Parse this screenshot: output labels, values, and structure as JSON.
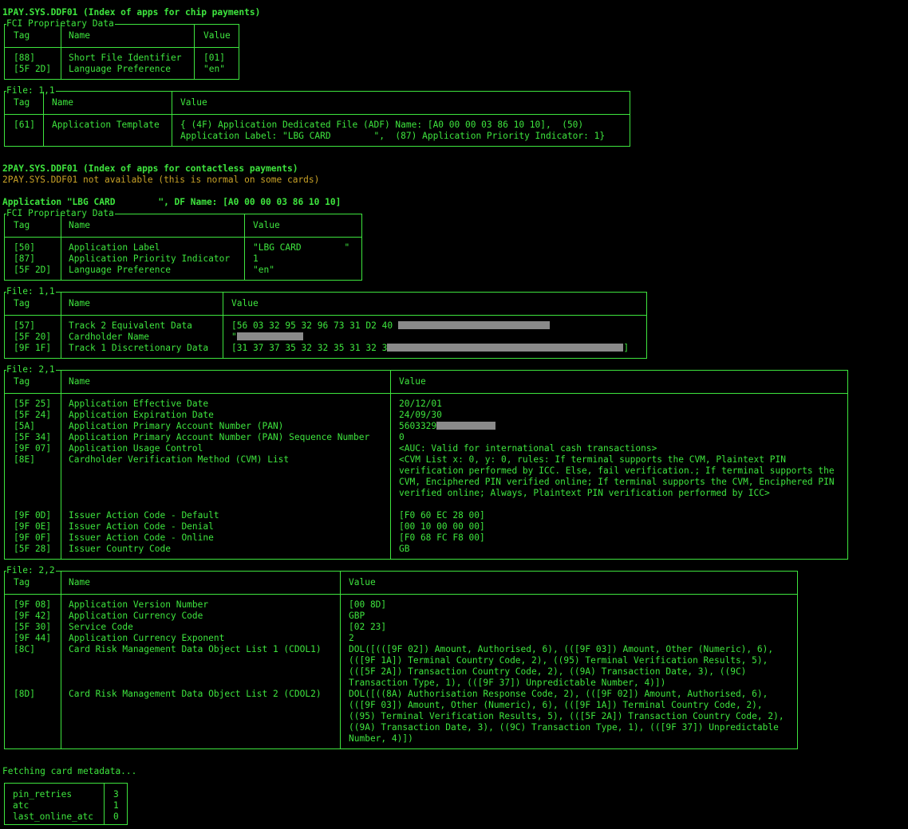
{
  "header_ppse": "1PAY.SYS.DDF01 (Index of apps for chip payments)",
  "fci1": {
    "label": "FCI Proprietary Data",
    "cols": [
      "Tag",
      "Name",
      "Value"
    ],
    "rows": [
      {
        "tag": "[88]",
        "name": "Short File Identifier",
        "value": "[01]"
      },
      {
        "tag": "[5F 2D]",
        "name": "Language Preference",
        "value": "\"en\""
      }
    ]
  },
  "file11a": {
    "label": "File: 1,1",
    "cols": [
      "Tag",
      "Name",
      "Value"
    ],
    "rows": [
      {
        "tag": "[61]",
        "name": "Application Template",
        "value_l1": "{ (4F) Application Dedicated File (ADF) Name: [A0 00 00 03 86 10 10],  (50)",
        "value_l2": "Application Label: \"LBG CARD        \",  (87) Application Priority Indicator: 1}"
      }
    ]
  },
  "header_contactless": "2PAY.SYS.DDF01 (Index of apps for contactless payments)",
  "contactless_msg": "2PAY.SYS.DDF01 not available (this is normal on some cards)",
  "header_app": "Application \"LBG CARD        \", DF Name: [A0 00 00 03 86 10 10]",
  "fci2": {
    "label": "FCI Proprietary Data",
    "cols": [
      "Tag",
      "Name",
      "Value"
    ],
    "rows": [
      {
        "tag": "[50]",
        "name": "Application Label",
        "value": "\"LBG CARD        \""
      },
      {
        "tag": "[87]",
        "name": "Application Priority Indicator",
        "value": "1"
      },
      {
        "tag": "[5F 2D]",
        "name": "Language Preference",
        "value": "\"en\""
      }
    ]
  },
  "file11b": {
    "label": "File: 1,1",
    "cols": [
      "Tag",
      "Name",
      "Value"
    ],
    "rows": [
      {
        "tag": "[57]",
        "name": "Track 2 Equivalent Data",
        "value": "[56 03 32 95 32 96 73 31 D2 40 "
      },
      {
        "tag": "[5F 20]",
        "name": "Cardholder Name",
        "value": "\""
      },
      {
        "tag": "[9F 1F]",
        "name": "Track 1 Discretionary Data",
        "value": "[31 37 37 35 32 32 35 31 32 3",
        "value_end": "]"
      }
    ]
  },
  "file21": {
    "label": "File: 2,1",
    "cols": [
      "Tag",
      "Name",
      "Value"
    ],
    "rows": [
      {
        "tag": "[5F 25]",
        "name": "Application Effective Date",
        "value": "20/12/01"
      },
      {
        "tag": "[5F 24]",
        "name": "Application Expiration Date",
        "value": "24/09/30"
      },
      {
        "tag": "[5A]",
        "name": "Application Primary Account Number (PAN)",
        "value": "5603329"
      },
      {
        "tag": "[5F 34]",
        "name": "Application Primary Account Number (PAN) Sequence Number",
        "value": "0"
      },
      {
        "tag": "[9F 07]",
        "name": "Application Usage Control",
        "value": "<AUC: Valid for international cash transactions>"
      },
      {
        "tag": "[8E]",
        "name": "Cardholder Verification Method (CVM) List",
        "value": "<CVM List x: 0, y: 0, rules: If terminal supports the CVM, Plaintext PIN verification performed by ICC. Else, fail verification.; If terminal supports the CVM, Enciphered PIN verified online; If terminal supports the CVM, Enciphered PIN verified online; Always, Plaintext PIN verification performed by ICC>"
      },
      {
        "tag": "[9F 0D]",
        "name": "Issuer Action Code - Default",
        "value": "[F0 60 EC 28 00]"
      },
      {
        "tag": "[9F 0E]",
        "name": "Issuer Action Code - Denial",
        "value": "[00 10 00 00 00]"
      },
      {
        "tag": "[9F 0F]",
        "name": "Issuer Action Code - Online",
        "value": "[F0 68 FC F8 00]"
      },
      {
        "tag": "[5F 28]",
        "name": "Issuer Country Code",
        "value": "GB"
      }
    ]
  },
  "file22": {
    "label": "File: 2,2",
    "cols": [
      "Tag",
      "Name",
      "Value"
    ],
    "rows": [
      {
        "tag": "[9F 08]",
        "name": "Application Version Number",
        "value": "[00 8D]"
      },
      {
        "tag": "[9F 42]",
        "name": "Application Currency Code",
        "value": "GBP"
      },
      {
        "tag": "[5F 30]",
        "name": "Service Code",
        "value": "[02 23]"
      },
      {
        "tag": "[9F 44]",
        "name": "Application Currency Exponent",
        "value": "2"
      },
      {
        "tag": "[8C]",
        "name": "Card Risk Management Data Object List 1 (CDOL1)",
        "value": "DOL([(([9F 02]) Amount, Authorised, 6), (([9F 03]) Amount, Other (Numeric), 6), (([9F 1A]) Terminal Country Code, 2), ((95) Terminal Verification Results, 5), (([5F 2A]) Transaction Country Code, 2), ((9A) Transaction Date, 3), ((9C) Transaction Type, 1), (([9F 37]) Unpredictable Number, 4)])"
      },
      {
        "tag": "[8D]",
        "name": "Card Risk Management Data Object List 2 (CDOL2)",
        "value": "DOL([((8A) Authorisation Response Code, 2), (([9F 02]) Amount, Authorised, 6), (([9F 03]) Amount, Other (Numeric), 6), (([9F 1A]) Terminal Country Code, 2), ((95) Terminal Verification Results, 5), (([5F 2A]) Transaction Country Code, 2), ((9A) Transaction Date, 3), ((9C) Transaction Type, 1), (([9F 37]) Unpredictable Number, 4)])"
      }
    ]
  },
  "fetching_msg": "Fetching card metadata...",
  "meta": {
    "rows": [
      {
        "key": "pin_retries",
        "value": "3"
      },
      {
        "key": "atc",
        "value": "1"
      },
      {
        "key": "last_online_atc",
        "value": "0"
      }
    ]
  }
}
